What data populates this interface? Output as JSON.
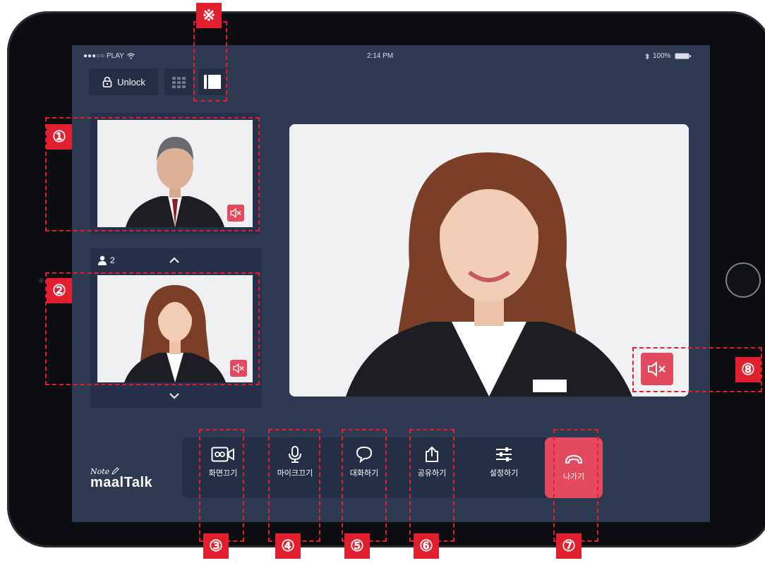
{
  "status_bar": {
    "carrier": "●●●○○ PLAY",
    "time": "2:14 PM",
    "battery": "100%"
  },
  "header": {
    "unlock_label": "Unlock",
    "lock_icon": "lock-icon",
    "view_modes": [
      "grid-view-icon",
      "single-view-icon"
    ]
  },
  "participants": {
    "count": "2",
    "person_icon": "person-icon"
  },
  "toolbar": {
    "items": [
      {
        "label": "화면끄기",
        "icon": "video-icon"
      },
      {
        "label": "마이크끄기",
        "icon": "microphone-icon"
      },
      {
        "label": "대화하기",
        "icon": "chat-bubble-icon"
      },
      {
        "label": "공유하기",
        "icon": "share-icon"
      },
      {
        "label": "설정하기",
        "icon": "settings-sliders-icon"
      }
    ],
    "leave": {
      "label": "나가기",
      "icon": "hang-up-icon"
    }
  },
  "logo": {
    "note": "Note",
    "main": "maalTalk"
  },
  "annotations": {
    "markers": [
      "※",
      "①",
      "②",
      "③",
      "④",
      "⑤",
      "⑥",
      "⑦",
      "⑧"
    ]
  },
  "colors": {
    "screen_bg": "#2e3a52",
    "panel_bg": "#26304a",
    "accent": "#e34a60",
    "annotation": "#e21f2e"
  }
}
